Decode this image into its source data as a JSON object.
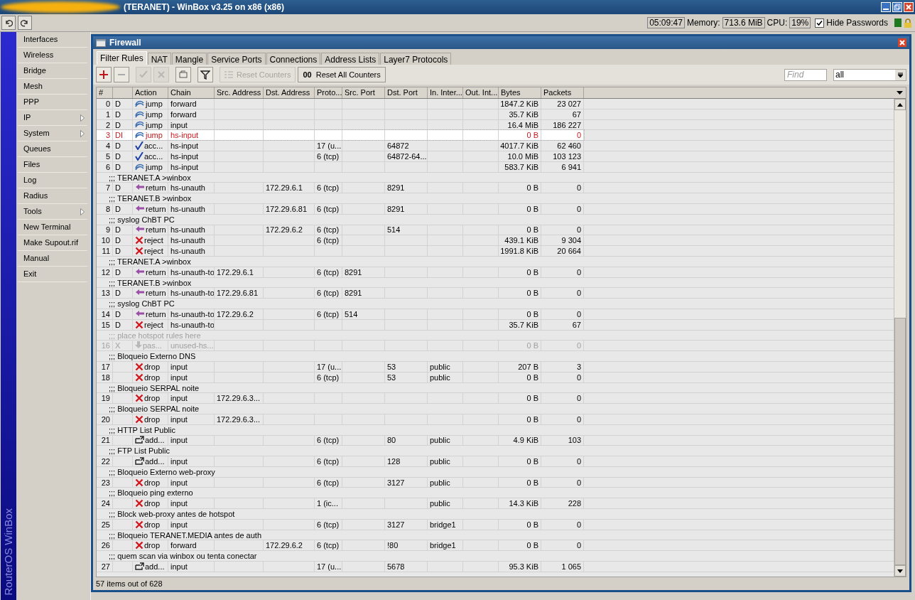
{
  "window": {
    "title": "(TERANET) - WinBox v3.25 on x86 (x86)"
  },
  "top_bar": {
    "time": "05:09:47",
    "memory_label": "Memory:",
    "memory": "713.6 MiB",
    "cpu_label": "CPU:",
    "cpu": "19%",
    "hide_passwords": {
      "label": "Hide Passwords",
      "checked": true
    }
  },
  "sidebar": {
    "brand": "RouterOS WinBox",
    "items": [
      {
        "label": "Interfaces",
        "has_submenu": false
      },
      {
        "label": "Wireless",
        "has_submenu": false
      },
      {
        "label": "Bridge",
        "has_submenu": false
      },
      {
        "label": "Mesh",
        "has_submenu": false
      },
      {
        "label": "PPP",
        "has_submenu": false
      },
      {
        "label": "IP",
        "has_submenu": true
      },
      {
        "label": "System",
        "has_submenu": true
      },
      {
        "label": "Queues",
        "has_submenu": false
      },
      {
        "label": "Files",
        "has_submenu": false
      },
      {
        "label": "Log",
        "has_submenu": false
      },
      {
        "label": "Radius",
        "has_submenu": false
      },
      {
        "label": "Tools",
        "has_submenu": true
      },
      {
        "label": "New Terminal",
        "has_submenu": false
      },
      {
        "label": "Make Supout.rif",
        "has_submenu": false
      },
      {
        "label": "Manual",
        "has_submenu": false
      },
      {
        "label": "Exit",
        "has_submenu": false
      }
    ]
  },
  "firewall": {
    "title": "Firewall",
    "tabs": [
      {
        "label": "Filter Rules",
        "selected": true
      },
      {
        "label": "NAT",
        "selected": false
      },
      {
        "label": "Mangle",
        "selected": false
      },
      {
        "label": "Service Ports",
        "selected": false
      },
      {
        "label": "Connections",
        "selected": false
      },
      {
        "label": "Address Lists",
        "selected": false
      },
      {
        "label": "Layer7 Protocols",
        "selected": false
      }
    ],
    "toolbar": {
      "icon_buttons": [
        {
          "kind": "add",
          "disabled": false
        },
        {
          "kind": "remove",
          "disabled": false
        },
        {
          "kind": "enable",
          "disabled": true
        },
        {
          "kind": "disable",
          "disabled": true
        },
        {
          "kind": "comment",
          "disabled": false
        },
        {
          "kind": "filter",
          "disabled": false
        }
      ],
      "reset_counters": {
        "label": "Reset Counters",
        "disabled": true
      },
      "reset_all_counters": {
        "label": "Reset All Counters",
        "icon_text": "00",
        "disabled": false
      },
      "find": {
        "placeholder": "Find"
      },
      "filter_select": {
        "value": "all"
      }
    },
    "table": {
      "columns": [
        "#",
        "Action",
        "Chain",
        "Src. Address",
        "Dst. Address",
        "Proto...",
        "Src. Port",
        "Dst. Port",
        "In. Inter...",
        "Out. Int...",
        "Bytes",
        "Packets"
      ],
      "rows": [
        {
          "kind": "jump",
          "num": "0",
          "flags": "D",
          "action": "jump",
          "chain": "forward",
          "bytes": "1847.2 KiB",
          "packets": "23 027",
          "selected": false,
          "invalid": false,
          "disabled": false
        },
        {
          "kind": "jump",
          "num": "1",
          "flags": "D",
          "action": "jump",
          "chain": "forward",
          "bytes": "35.7 KiB",
          "packets": "67",
          "selected": false,
          "invalid": false,
          "disabled": false
        },
        {
          "kind": "jump",
          "num": "2",
          "flags": "D",
          "action": "jump",
          "chain": "input",
          "bytes": "16.4 MiB",
          "packets": "186 227",
          "selected": false,
          "invalid": false,
          "disabled": false
        },
        {
          "kind": "jump",
          "num": "3",
          "flags": "DI",
          "action": "jump",
          "chain": "hs-input",
          "bytes": "0 B",
          "packets": "0",
          "selected": true,
          "invalid": true,
          "disabled": false
        },
        {
          "kind": "accept",
          "num": "4",
          "flags": "D",
          "action": "acc...",
          "chain": "hs-input",
          "protocol": "17 (u...",
          "dst_port": "64872",
          "bytes": "4017.7 KiB",
          "packets": "62 460",
          "selected": false,
          "invalid": false,
          "disabled": false
        },
        {
          "kind": "accept",
          "num": "5",
          "flags": "D",
          "action": "acc...",
          "chain": "hs-input",
          "protocol": "6 (tcp)",
          "dst_port": "64872-64...",
          "bytes": "10.0 MiB",
          "packets": "103 123",
          "selected": false,
          "invalid": false,
          "disabled": false
        },
        {
          "kind": "jump",
          "num": "6",
          "flags": "D",
          "action": "jump",
          "chain": "hs-input",
          "bytes": "583.7 KiB",
          "packets": "6 941",
          "selected": false,
          "invalid": false,
          "disabled": false
        },
        {
          "kind": "comment",
          "text": ";;; TERANET.A >winbox",
          "disabled": false
        },
        {
          "kind": "return",
          "num": "7",
          "flags": "D",
          "action": "return",
          "chain": "hs-unauth",
          "dst_address": "172.29.6.1",
          "protocol": "6 (tcp)",
          "dst_port": "8291",
          "bytes": "0 B",
          "packets": "0",
          "selected": false,
          "invalid": false,
          "disabled": false
        },
        {
          "kind": "comment",
          "text": ";;; TERANET.B >winbox",
          "disabled": false
        },
        {
          "kind": "return",
          "num": "8",
          "flags": "D",
          "action": "return",
          "chain": "hs-unauth",
          "dst_address": "172.29.6.81",
          "protocol": "6 (tcp)",
          "dst_port": "8291",
          "bytes": "0 B",
          "packets": "0",
          "selected": false,
          "invalid": false,
          "disabled": false
        },
        {
          "kind": "comment",
          "text": ";;; syslog ChBT PC",
          "disabled": false
        },
        {
          "kind": "return",
          "num": "9",
          "flags": "D",
          "action": "return",
          "chain": "hs-unauth",
          "dst_address": "172.29.6.2",
          "protocol": "6 (tcp)",
          "dst_port": "514",
          "bytes": "0 B",
          "packets": "0",
          "selected": false,
          "invalid": false,
          "disabled": false
        },
        {
          "kind": "reject",
          "num": "10",
          "flags": "D",
          "action": "reject",
          "chain": "hs-unauth",
          "protocol": "6 (tcp)",
          "bytes": "439.1 KiB",
          "packets": "9 304",
          "selected": false,
          "invalid": false,
          "disabled": false
        },
        {
          "kind": "reject",
          "num": "11",
          "flags": "D",
          "action": "reject",
          "chain": "hs-unauth",
          "bytes": "1991.8 KiB",
          "packets": "20 664",
          "selected": false,
          "invalid": false,
          "disabled": false
        },
        {
          "kind": "comment",
          "text": ";;; TERANET.A >winbox",
          "disabled": false
        },
        {
          "kind": "return",
          "num": "12",
          "flags": "D",
          "action": "return",
          "chain": "hs-unauth-to",
          "src_address": "172.29.6.1",
          "protocol": "6 (tcp)",
          "src_port": "8291",
          "bytes": "0 B",
          "packets": "0",
          "selected": false,
          "invalid": false,
          "disabled": false
        },
        {
          "kind": "comment",
          "text": ";;; TERANET.B >winbox",
          "disabled": false
        },
        {
          "kind": "return",
          "num": "13",
          "flags": "D",
          "action": "return",
          "chain": "hs-unauth-to",
          "src_address": "172.29.6.81",
          "protocol": "6 (tcp)",
          "src_port": "8291",
          "bytes": "0 B",
          "packets": "0",
          "selected": false,
          "invalid": false,
          "disabled": false
        },
        {
          "kind": "comment",
          "text": ";;; syslog ChBT PC",
          "disabled": false
        },
        {
          "kind": "return",
          "num": "14",
          "flags": "D",
          "action": "return",
          "chain": "hs-unauth-to",
          "src_address": "172.29.6.2",
          "protocol": "6 (tcp)",
          "src_port": "514",
          "bytes": "0 B",
          "packets": "0",
          "selected": false,
          "invalid": false,
          "disabled": false
        },
        {
          "kind": "reject",
          "num": "15",
          "flags": "D",
          "action": "reject",
          "chain": "hs-unauth-to",
          "bytes": "35.7 KiB",
          "packets": "67",
          "selected": false,
          "invalid": false,
          "disabled": false
        },
        {
          "kind": "comment",
          "text": ";;; place hotspot rules here",
          "disabled": true
        },
        {
          "kind": "passthrough",
          "num": "16",
          "flags": "X",
          "action": "pas...",
          "chain": "unused-hs...",
          "bytes": "0 B",
          "packets": "0",
          "selected": false,
          "invalid": false,
          "disabled": true
        },
        {
          "kind": "comment",
          "text": ";;; Bloqueio Externo DNS",
          "disabled": false
        },
        {
          "kind": "drop",
          "num": "17",
          "action": "drop",
          "chain": "input",
          "protocol": "17 (u...",
          "dst_port": "53",
          "in_interface": "public",
          "bytes": "207 B",
          "packets": "3",
          "selected": false,
          "invalid": false,
          "disabled": false
        },
        {
          "kind": "drop",
          "num": "18",
          "action": "drop",
          "chain": "input",
          "protocol": "6 (tcp)",
          "dst_port": "53",
          "in_interface": "public",
          "bytes": "0 B",
          "packets": "0",
          "selected": false,
          "invalid": false,
          "disabled": false
        },
        {
          "kind": "comment",
          "text": ";;; Bloqueio SERPAL noite",
          "disabled": false
        },
        {
          "kind": "drop",
          "num": "19",
          "action": "drop",
          "chain": "input",
          "src_address": "172.29.6.3...",
          "bytes": "0 B",
          "packets": "0",
          "selected": false,
          "invalid": false,
          "disabled": false
        },
        {
          "kind": "comment",
          "text": ";;; Bloqueio SERPAL noite",
          "disabled": false
        },
        {
          "kind": "drop",
          "num": "20",
          "action": "drop",
          "chain": "input",
          "src_address": "172.29.6.3...",
          "bytes": "0 B",
          "packets": "0",
          "selected": false,
          "invalid": false,
          "disabled": false
        },
        {
          "kind": "comment",
          "text": ";;; HTTP List Public",
          "disabled": false
        },
        {
          "kind": "add",
          "num": "21",
          "action": "add...",
          "chain": "input",
          "protocol": "6 (tcp)",
          "dst_port": "80",
          "in_interface": "public",
          "bytes": "4.9 KiB",
          "packets": "103",
          "selected": false,
          "invalid": false,
          "disabled": false
        },
        {
          "kind": "comment",
          "text": ";;; FTP List Public",
          "disabled": false
        },
        {
          "kind": "add",
          "num": "22",
          "action": "add...",
          "chain": "input",
          "protocol": "6 (tcp)",
          "dst_port": "128",
          "in_interface": "public",
          "bytes": "0 B",
          "packets": "0",
          "selected": false,
          "invalid": false,
          "disabled": false
        },
        {
          "kind": "comment",
          "text": ";;; Bloqueio Externo web-proxy",
          "disabled": false
        },
        {
          "kind": "drop",
          "num": "23",
          "action": "drop",
          "chain": "input",
          "protocol": "6 (tcp)",
          "dst_port": "3127",
          "in_interface": "public",
          "bytes": "0 B",
          "packets": "0",
          "selected": false,
          "invalid": false,
          "disabled": false
        },
        {
          "kind": "comment",
          "text": ";;; Bloqueio ping externo",
          "disabled": false
        },
        {
          "kind": "drop",
          "num": "24",
          "action": "drop",
          "chain": "input",
          "protocol": "1 (ic...",
          "in_interface": "public",
          "bytes": "14.3 KiB",
          "packets": "228",
          "selected": false,
          "invalid": false,
          "disabled": false
        },
        {
          "kind": "comment",
          "text": ";;; Block web-proxy antes de hotspot",
          "disabled": false
        },
        {
          "kind": "drop",
          "num": "25",
          "action": "drop",
          "chain": "input",
          "protocol": "6 (tcp)",
          "dst_port": "3127",
          "in_interface": "bridge1",
          "bytes": "0 B",
          "packets": "0",
          "selected": false,
          "invalid": false,
          "disabled": false
        },
        {
          "kind": "comment",
          "text": ";;; Bloqueio TERANET.MEDIA antes de auth",
          "disabled": false
        },
        {
          "kind": "drop",
          "num": "26",
          "action": "drop",
          "chain": "forward",
          "dst_address": "172.29.6.2",
          "protocol": "6 (tcp)",
          "dst_port": "!80",
          "in_interface": "bridge1",
          "bytes": "0 B",
          "packets": "0",
          "selected": false,
          "invalid": false,
          "disabled": false
        },
        {
          "kind": "comment",
          "text": ";;; quem scan via winbox ou tenta conectar",
          "disabled": false
        },
        {
          "kind": "add",
          "num": "27",
          "action": "add...",
          "chain": "input",
          "protocol": "17 (u...",
          "dst_port": "5678",
          "bytes": "95.3 KiB",
          "packets": "1 065",
          "selected": false,
          "invalid": false,
          "disabled": false
        }
      ]
    },
    "status_bar": "57 items out of 628"
  }
}
